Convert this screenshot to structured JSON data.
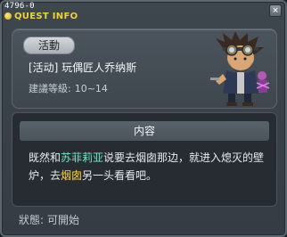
{
  "window": {
    "quest_id": "4796-0",
    "title": "QUEST INFO",
    "close_glyph": "×"
  },
  "quest": {
    "badge": "活動",
    "name": "[活动] 玩偶匠人乔纳斯",
    "level_label": "建議等級:",
    "level_value": "10~14"
  },
  "content": {
    "header": "内容",
    "text_1": "既然和",
    "highlight_1": "苏菲莉亚",
    "text_2": "说要去烟囱那边，就进入熄灭的壁炉，去",
    "highlight_2": "烟囱",
    "text_3": "另一头看看吧。"
  },
  "status": {
    "label": "狀態:",
    "value": "可開始"
  },
  "colors": {
    "highlight_green": "#74e6c2",
    "highlight_yellow": "#ffd83a",
    "title_yellow": "#f0d23a"
  }
}
